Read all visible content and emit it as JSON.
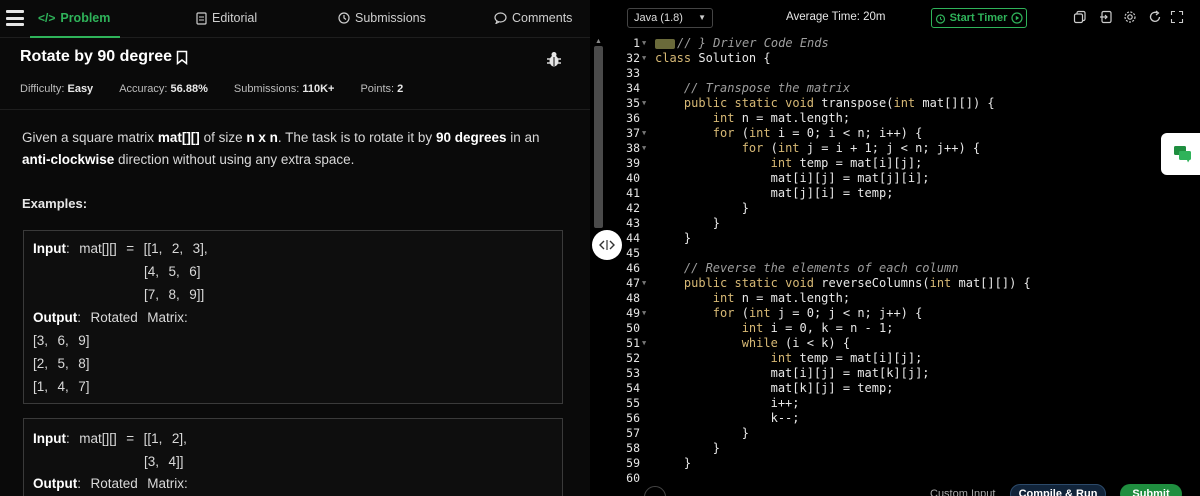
{
  "tabs": {
    "problem": "Problem",
    "editorial": "Editorial",
    "submissions": "Submissions",
    "comments": "Comments"
  },
  "problem": {
    "title": "Rotate by 90 degree",
    "difficulty_label": "Difficulty:",
    "difficulty_value": "Easy",
    "accuracy_label": "Accuracy:",
    "accuracy_value": "56.88%",
    "submissions_label": "Submissions:",
    "submissions_value": "110K+",
    "points_label": "Points:",
    "points_value": "2",
    "desc": {
      "p1": "Given a square matrix ",
      "b1": "mat[][]",
      "p2": " of size ",
      "b2": "n x n",
      "p3": ". The task is to rotate it by ",
      "b3": "90 degrees",
      "p4": " in an ",
      "b4": "anti-clockwise",
      "p5": " direction without using any extra space."
    },
    "examples_label": "Examples:",
    "example1": {
      "input_label": "Input",
      "line1": ":  mat[][]  =  [[1,  2,  3],",
      "line2": "[4,  5,  6]",
      "line3": "[7,  8,  9]]",
      "output_label": "Output",
      "output_text": ":  Rotated  Matrix:",
      "out1": "[3,  6,  9]",
      "out2": "[2,  5,  8]",
      "out3": "[1,  4,  7]"
    },
    "example2": {
      "input_label": "Input",
      "line1": ":  mat[][]  =  [[1,  2],",
      "line2": "[3,  4]]",
      "output_label": "Output",
      "output_text": ":  Rotated  Matrix:"
    }
  },
  "editor": {
    "language": "Java (1.8)",
    "avg_time": "Average Time: 20m",
    "start_timer": "Start Timer",
    "custom_input": "Custom Input",
    "compile_run": "Compile & Run",
    "submit": "Submit"
  },
  "code_lines": [
    {
      "n": "1",
      "fold": true,
      "text": "// } Driver Code Ends",
      "kind": "comment",
      "badge": true
    },
    {
      "n": "32",
      "fold": true,
      "text": "class Solution {",
      "kind": "code"
    },
    {
      "n": "33",
      "fold": false,
      "text": "",
      "kind": "code"
    },
    {
      "n": "34",
      "fold": false,
      "text": "    // Transpose the matrix",
      "kind": "comment"
    },
    {
      "n": "35",
      "fold": true,
      "text": "    public static void transpose(int mat[][]) {",
      "kind": "code"
    },
    {
      "n": "36",
      "fold": false,
      "text": "        int n = mat.length;",
      "kind": "code"
    },
    {
      "n": "37",
      "fold": true,
      "text": "        for (int i = 0; i < n; i++) {",
      "kind": "code"
    },
    {
      "n": "38",
      "fold": true,
      "text": "            for (int j = i + 1; j < n; j++) {",
      "kind": "code"
    },
    {
      "n": "39",
      "fold": false,
      "text": "                int temp = mat[i][j];",
      "kind": "code"
    },
    {
      "n": "40",
      "fold": false,
      "text": "                mat[i][j] = mat[j][i];",
      "kind": "code"
    },
    {
      "n": "41",
      "fold": false,
      "text": "                mat[j][i] = temp;",
      "kind": "code"
    },
    {
      "n": "42",
      "fold": false,
      "text": "            }",
      "kind": "code"
    },
    {
      "n": "43",
      "fold": false,
      "text": "        }",
      "kind": "code"
    },
    {
      "n": "44",
      "fold": false,
      "text": "    }",
      "kind": "code"
    },
    {
      "n": "45",
      "fold": false,
      "text": "",
      "kind": "code"
    },
    {
      "n": "46",
      "fold": false,
      "text": "    // Reverse the elements of each column",
      "kind": "comment"
    },
    {
      "n": "47",
      "fold": true,
      "text": "    public static void reverseColumns(int mat[][]) {",
      "kind": "code"
    },
    {
      "n": "48",
      "fold": false,
      "text": "        int n = mat.length;",
      "kind": "code"
    },
    {
      "n": "49",
      "fold": true,
      "text": "        for (int j = 0; j < n; j++) {",
      "kind": "code"
    },
    {
      "n": "50",
      "fold": false,
      "text": "            int i = 0, k = n - 1;",
      "kind": "code"
    },
    {
      "n": "51",
      "fold": true,
      "text": "            while (i < k) {",
      "kind": "code"
    },
    {
      "n": "52",
      "fold": false,
      "text": "                int temp = mat[i][j];",
      "kind": "code"
    },
    {
      "n": "53",
      "fold": false,
      "text": "                mat[i][j] = mat[k][j];",
      "kind": "code"
    },
    {
      "n": "54",
      "fold": false,
      "text": "                mat[k][j] = temp;",
      "kind": "code"
    },
    {
      "n": "55",
      "fold": false,
      "text": "                i++;",
      "kind": "code"
    },
    {
      "n": "56",
      "fold": false,
      "text": "                k--;",
      "kind": "code"
    },
    {
      "n": "57",
      "fold": false,
      "text": "            }",
      "kind": "code"
    },
    {
      "n": "58",
      "fold": false,
      "text": "        }",
      "kind": "code"
    },
    {
      "n": "59",
      "fold": false,
      "text": "    }",
      "kind": "code"
    },
    {
      "n": "60",
      "fold": false,
      "text": "",
      "kind": "code"
    }
  ],
  "colors": {
    "accent_green": "#2fb35a",
    "keyword": "#d7b975",
    "comment": "#9e9e9e"
  }
}
